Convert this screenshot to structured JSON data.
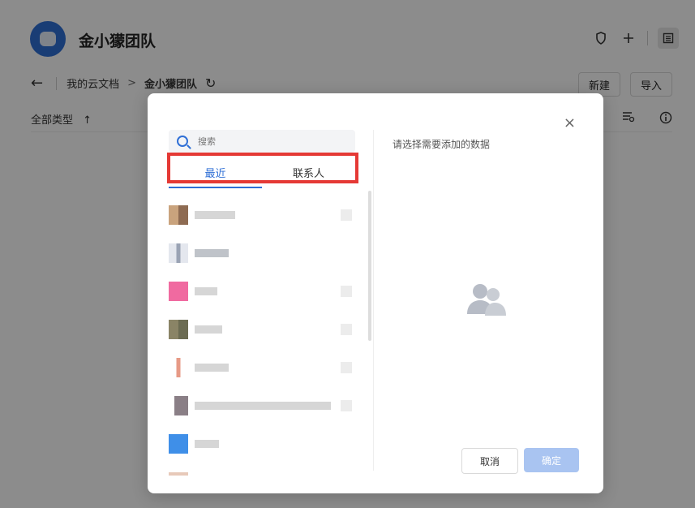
{
  "app": {
    "team_name": "金小獴团队",
    "breadcrumb": {
      "parent": "我的云文档",
      "separator": ">",
      "current": "金小獴团队"
    },
    "buttons": {
      "new": "新建",
      "import": "导入"
    },
    "filter": {
      "type_label": "全部类型",
      "sort_icon": "↑"
    },
    "icons": [
      "shield-icon",
      "plus-icon",
      "sidebar-toggle-icon",
      "back-icon",
      "refresh-icon",
      "filter-settings-icon",
      "info-icon"
    ]
  },
  "modal": {
    "search_placeholder": "搜索",
    "tabs": [
      {
        "label": "最近",
        "active": true
      },
      {
        "label": "联系人",
        "active": false
      }
    ],
    "right_prompt": "请选择需要添加的数据",
    "cancel_label": "取消",
    "confirm_label": "确定",
    "close_glyph": "×"
  },
  "colors": {
    "accent": "#2f6fd6",
    "highlight_border": "#e53935",
    "confirm_disabled": "#a9c4f1"
  }
}
